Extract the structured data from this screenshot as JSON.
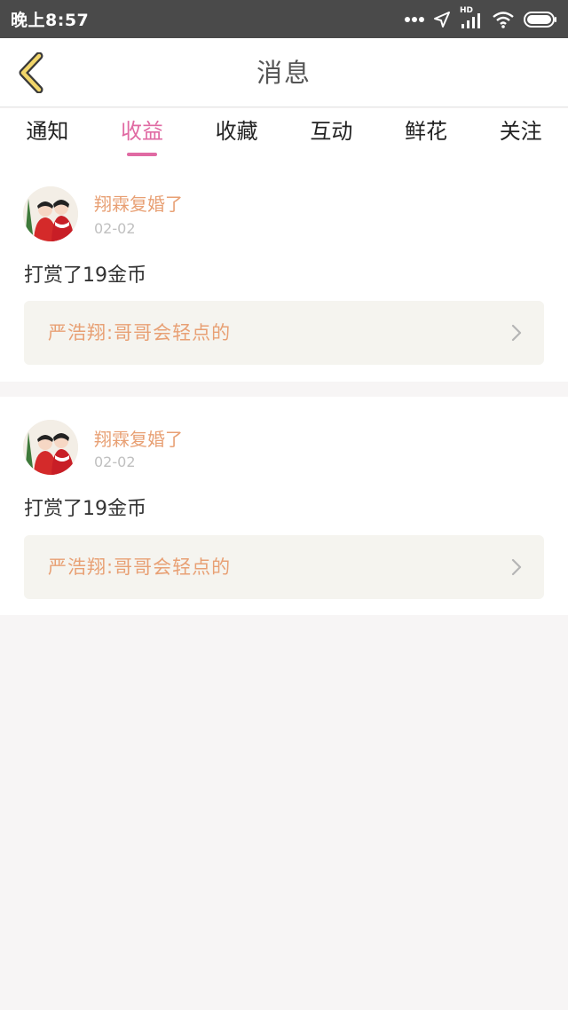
{
  "status_bar": {
    "time": "晚上8:57",
    "network_label": "HD"
  },
  "nav": {
    "title": "消息",
    "back_icon": "chevron-left-icon"
  },
  "tabs": [
    {
      "label": "通知",
      "active": false
    },
    {
      "label": "收益",
      "active": true
    },
    {
      "label": "收藏",
      "active": false
    },
    {
      "label": "互动",
      "active": false
    },
    {
      "label": "鲜花",
      "active": false
    },
    {
      "label": "关注",
      "active": false
    }
  ],
  "messages": [
    {
      "username": "翔霖复婚了",
      "date": "02-02",
      "text": "打赏了19金币",
      "quote": "严浩翔:哥哥会轻点的"
    },
    {
      "username": "翔霖复婚了",
      "date": "02-02",
      "text": "打赏了19金币",
      "quote": "严浩翔:哥哥会轻点的"
    }
  ],
  "colors": {
    "accent": "#e06aa3",
    "username": "#e8a074",
    "status_bar": "#4a4a4a",
    "background": "#f7f5f5",
    "quote_background": "#f5f4ef"
  }
}
